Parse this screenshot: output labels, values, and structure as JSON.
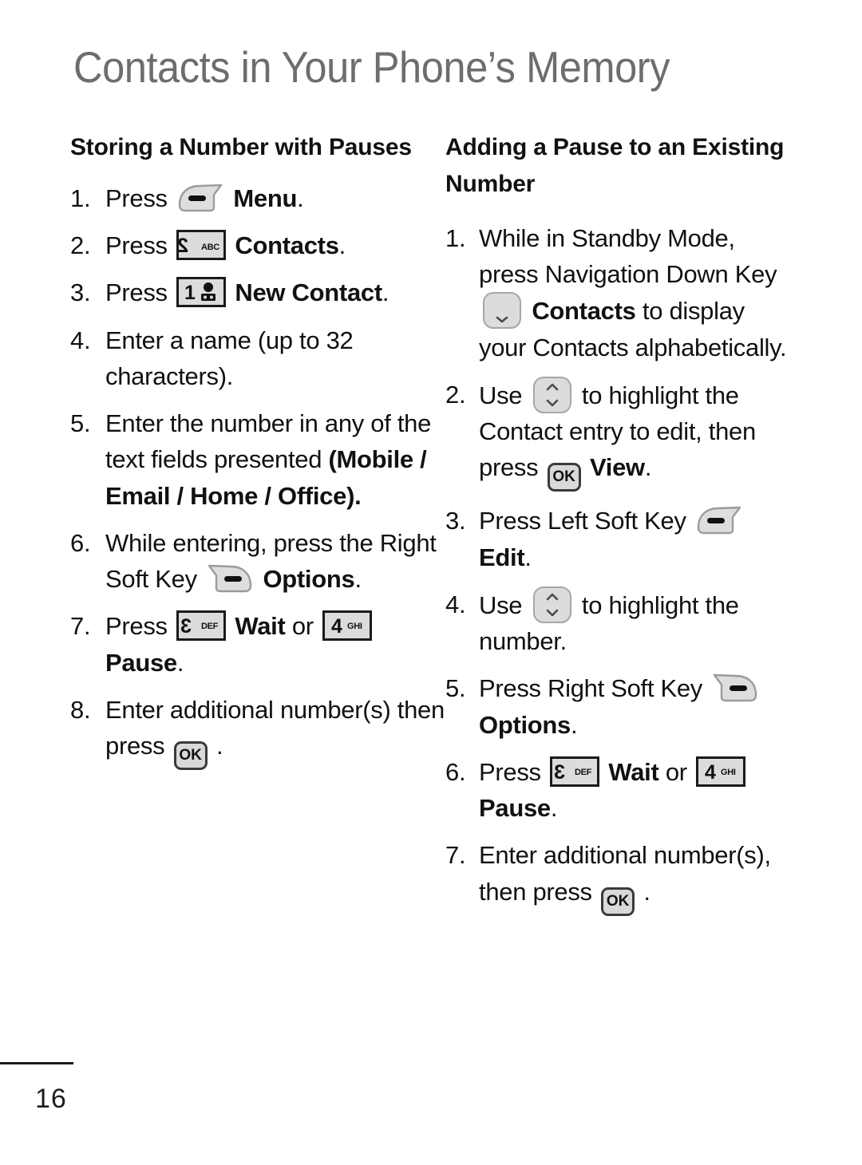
{
  "page": {
    "title": "Contacts in Your Phone’s Memory",
    "number": "16",
    "title_color": "#6d6d6d"
  },
  "left_column": {
    "heading": "Storing a Number with Pauses",
    "steps": [
      {
        "num": "1.",
        "pre": "Press",
        "icon": "left-soft-key",
        "post_bold": "Menu",
        "post": "."
      },
      {
        "num": "2.",
        "pre": "Press",
        "icon": "key-2-abc",
        "post_bold": "Contacts",
        "post": "."
      },
      {
        "num": "3.",
        "pre": "Press",
        "icon": "key-1-voicemail",
        "post_bold": "New Contact",
        "post": "."
      },
      {
        "num": "4.",
        "text": "Enter a name (up to 32 characters)."
      },
      {
        "num": "5.",
        "text": "Enter the number in any of the text fields presented ",
        "bold_tail": "(Mobile / Email / Home / Office)."
      },
      {
        "num": "6.",
        "pre": "While entering, press the Right Soft Key",
        "icon": "right-soft-key",
        "post_bold": "Options",
        "post": "."
      },
      {
        "num": "7.",
        "pre": "Press",
        "icon": "key-3-def",
        "mid_bold": "Wait",
        "mid": "or",
        "icon2": "key-4-ghi",
        "post_bold": "Pause",
        "post": "."
      },
      {
        "num": "8.",
        "pre": "Enter additional number(s) then press",
        "icon": "ok-key",
        "post": "."
      }
    ]
  },
  "right_column": {
    "heading": "Adding a Pause to an Existing Number",
    "steps": [
      {
        "num": "1.",
        "pre": "While in Standby Mode, press Navigation Down Key",
        "icon": "nav-down-key",
        "post_bold": "Contacts",
        "post": "to display your Contacts alphabetically."
      },
      {
        "num": "2.",
        "pre": "Use",
        "icon": "nav-up-down-key",
        "mid": "to highlight the Contact entry to edit, then press",
        "icon2": "ok-key",
        "post_bold": "View",
        "post": "."
      },
      {
        "num": "3.",
        "pre": "Press Left Soft Key",
        "icon": "left-soft-key",
        "post_bold": "Edit",
        "post": "."
      },
      {
        "num": "4.",
        "pre": "Use",
        "icon": "nav-up-down-key",
        "mid": "to highlight the number."
      },
      {
        "num": "5.",
        "pre": "Press Right Soft Key",
        "icon": "right-soft-key",
        "post_bold": "Options",
        "post": "."
      },
      {
        "num": "6.",
        "pre": "Press",
        "icon": "key-3-def",
        "mid_bold": "Wait",
        "mid": "or",
        "icon2": "key-4-ghi",
        "post_bold": "Pause",
        "post": "."
      },
      {
        "num": "7.",
        "pre": "Enter additional number(s), then press",
        "icon": "ok-key",
        "post": "."
      }
    ]
  },
  "keys": {
    "key_1_digit": "1",
    "key_2_digit": "2",
    "key_2_letters": "ABC",
    "key_3_digit": "3",
    "key_3_letters": "DEF",
    "key_4_digit": "4",
    "key_4_letters": "GHI",
    "ok_label": "OK"
  }
}
